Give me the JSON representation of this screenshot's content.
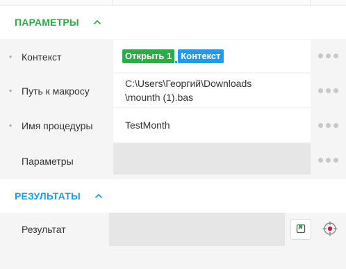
{
  "parameters_section": {
    "title": "ПАРАМЕТРЫ",
    "color": "#2bab4a",
    "rows": [
      {
        "label": "Контекст",
        "required": "*",
        "chips": [
          "Открыть 1",
          "Контекст"
        ]
      },
      {
        "label": "Путь к макросу",
        "required": "*",
        "value_line1": "C:\\Users\\Георгий\\Downloads",
        "value_line2": "\\mounth (1).bas"
      },
      {
        "label": "Имя процедуры",
        "required": "*",
        "value": "TestMonth"
      },
      {
        "label": "Параметры",
        "value": ""
      }
    ]
  },
  "results_section": {
    "title": "РЕЗУЛЬТАТЫ",
    "color": "#1e9bf0",
    "rows": [
      {
        "label": "Результат",
        "value": ""
      }
    ]
  },
  "icons": {
    "collapse": "chevron-up-icon",
    "more": "more-dots-icon",
    "create_variable": "new-variable-icon",
    "pick_target": "crosshair-target-icon"
  }
}
